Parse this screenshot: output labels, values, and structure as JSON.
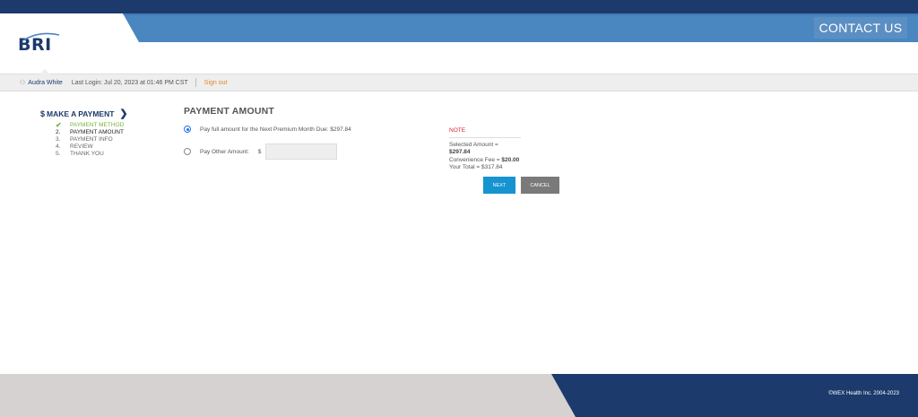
{
  "header": {
    "contact_label": "CONTACT US",
    "logo_text": "BRI",
    "colors": {
      "navy": "#1c3a6b",
      "blue": "#4a86c0",
      "accent_orange": "#e2872c"
    }
  },
  "user_bar": {
    "user_icon": "user-icon",
    "user_name": "Audra White",
    "last_login": "Last Login: Jul 20, 2023 at 01:46 PM CST",
    "signout_label": "Sign out"
  },
  "sidebar": {
    "heading": "MAKE A PAYMENT",
    "heading_icon": "$",
    "chevron": "❯",
    "steps": [
      {
        "num": "",
        "label": "PAYMENT METHOD",
        "state": "done"
      },
      {
        "num": "2.",
        "label": "PAYMENT AMOUNT",
        "state": "active"
      },
      {
        "num": "3.",
        "label": "PAYMENT INFO",
        "state": "pending"
      },
      {
        "num": "4.",
        "label": "REVIEW",
        "state": "pending"
      },
      {
        "num": "5.",
        "label": "THANK YOU",
        "state": "pending"
      }
    ]
  },
  "main": {
    "title": "PAYMENT AMOUNT",
    "option_full": "Pay full amount for the Next Premium Month Due: $297.84",
    "option_other": "Pay Other Amount:",
    "currency_symbol": "$",
    "other_amount_value": "",
    "other_amount_placeholder": ""
  },
  "note": {
    "title": "NOTE",
    "selected_label": "Selected Amount = ",
    "selected_value": "$297.84",
    "fee_label": "Convenience Fee = ",
    "fee_value": "$20.00",
    "total_label": "Your Total = ",
    "total_value": "$317.84"
  },
  "buttons": {
    "next": "NEXT",
    "cancel": "CANCEL"
  },
  "footer": {
    "copyright": "©WEX Health Inc. 2004-2023"
  }
}
